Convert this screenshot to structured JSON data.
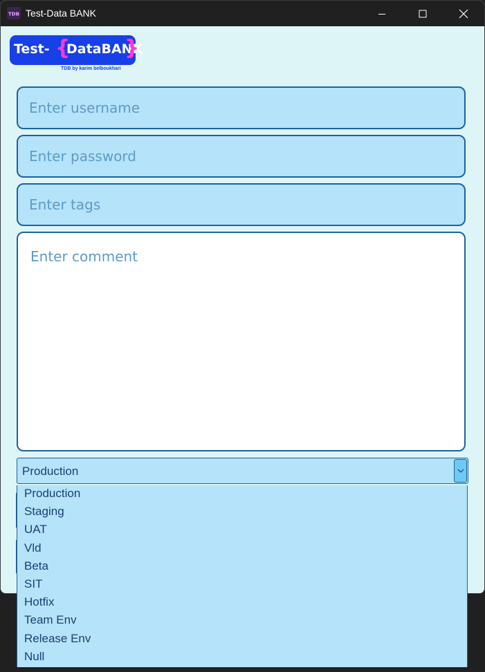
{
  "window": {
    "title": "Test-Data BANK",
    "icon_label": "TDB",
    "controls": [
      "minimize-icon",
      "maximize-icon",
      "close-icon"
    ]
  },
  "logo": {
    "part_test": "Test-",
    "brace_open": "{",
    "part_databank": "DataBANK",
    "brace_close": "}",
    "tagline": "TDB by karim belboukhari"
  },
  "form": {
    "username_placeholder": "Enter username",
    "password_placeholder": "Enter password",
    "tags_placeholder": "Enter tags",
    "comment_placeholder": "Enter comment"
  },
  "environment": {
    "selected": "Production",
    "options": [
      "Production",
      "Staging",
      "UAT",
      "Vld",
      "Beta",
      "SIT",
      "Hotfix",
      "Team Env",
      "Release Env",
      "Null"
    ]
  },
  "colors": {
    "accent": "#1b62a0",
    "field_bg": "#b5e3f9",
    "window_bg": "#def5f8",
    "logo_blue": "#1740e6",
    "logo_pink": "#ff38d6"
  }
}
